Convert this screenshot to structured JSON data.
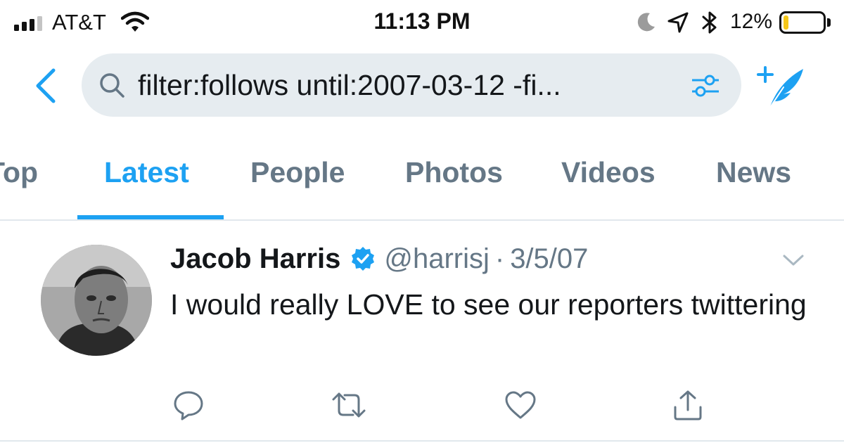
{
  "status_bar": {
    "carrier": "AT&T",
    "time": "11:13 PM",
    "battery_percent": "12%",
    "battery_level": 0.12,
    "battery_color": "#f5c718",
    "icons": [
      "signal-icon",
      "wifi-icon",
      "moon-icon",
      "location-icon",
      "bluetooth-icon",
      "battery-icon"
    ]
  },
  "header": {
    "back_icon": "chevron-left-icon",
    "search_query": "filter:follows until:2007-03-12 -fi...",
    "search_icon": "search-icon",
    "filter_icon": "sliders-icon",
    "compose_icon": "compose-tweet-icon"
  },
  "tabs": [
    {
      "label": "Top",
      "active": false
    },
    {
      "label": "Latest",
      "active": true
    },
    {
      "label": "People",
      "active": false
    },
    {
      "label": "Photos",
      "active": false
    },
    {
      "label": "Videos",
      "active": false
    },
    {
      "label": "News",
      "active": false
    }
  ],
  "tweet": {
    "author": "Jacob Harris",
    "verified": true,
    "handle": "@harrisj",
    "separator": "·",
    "date": "3/5/07",
    "text": "I would really LOVE to see our reporters twittering",
    "actions": [
      "reply-icon",
      "retweet-icon",
      "like-icon",
      "share-icon"
    ]
  },
  "colors": {
    "accent": "#1da1f2",
    "muted": "#657786",
    "text": "#14171a",
    "search_bg": "#e6ecf0"
  }
}
